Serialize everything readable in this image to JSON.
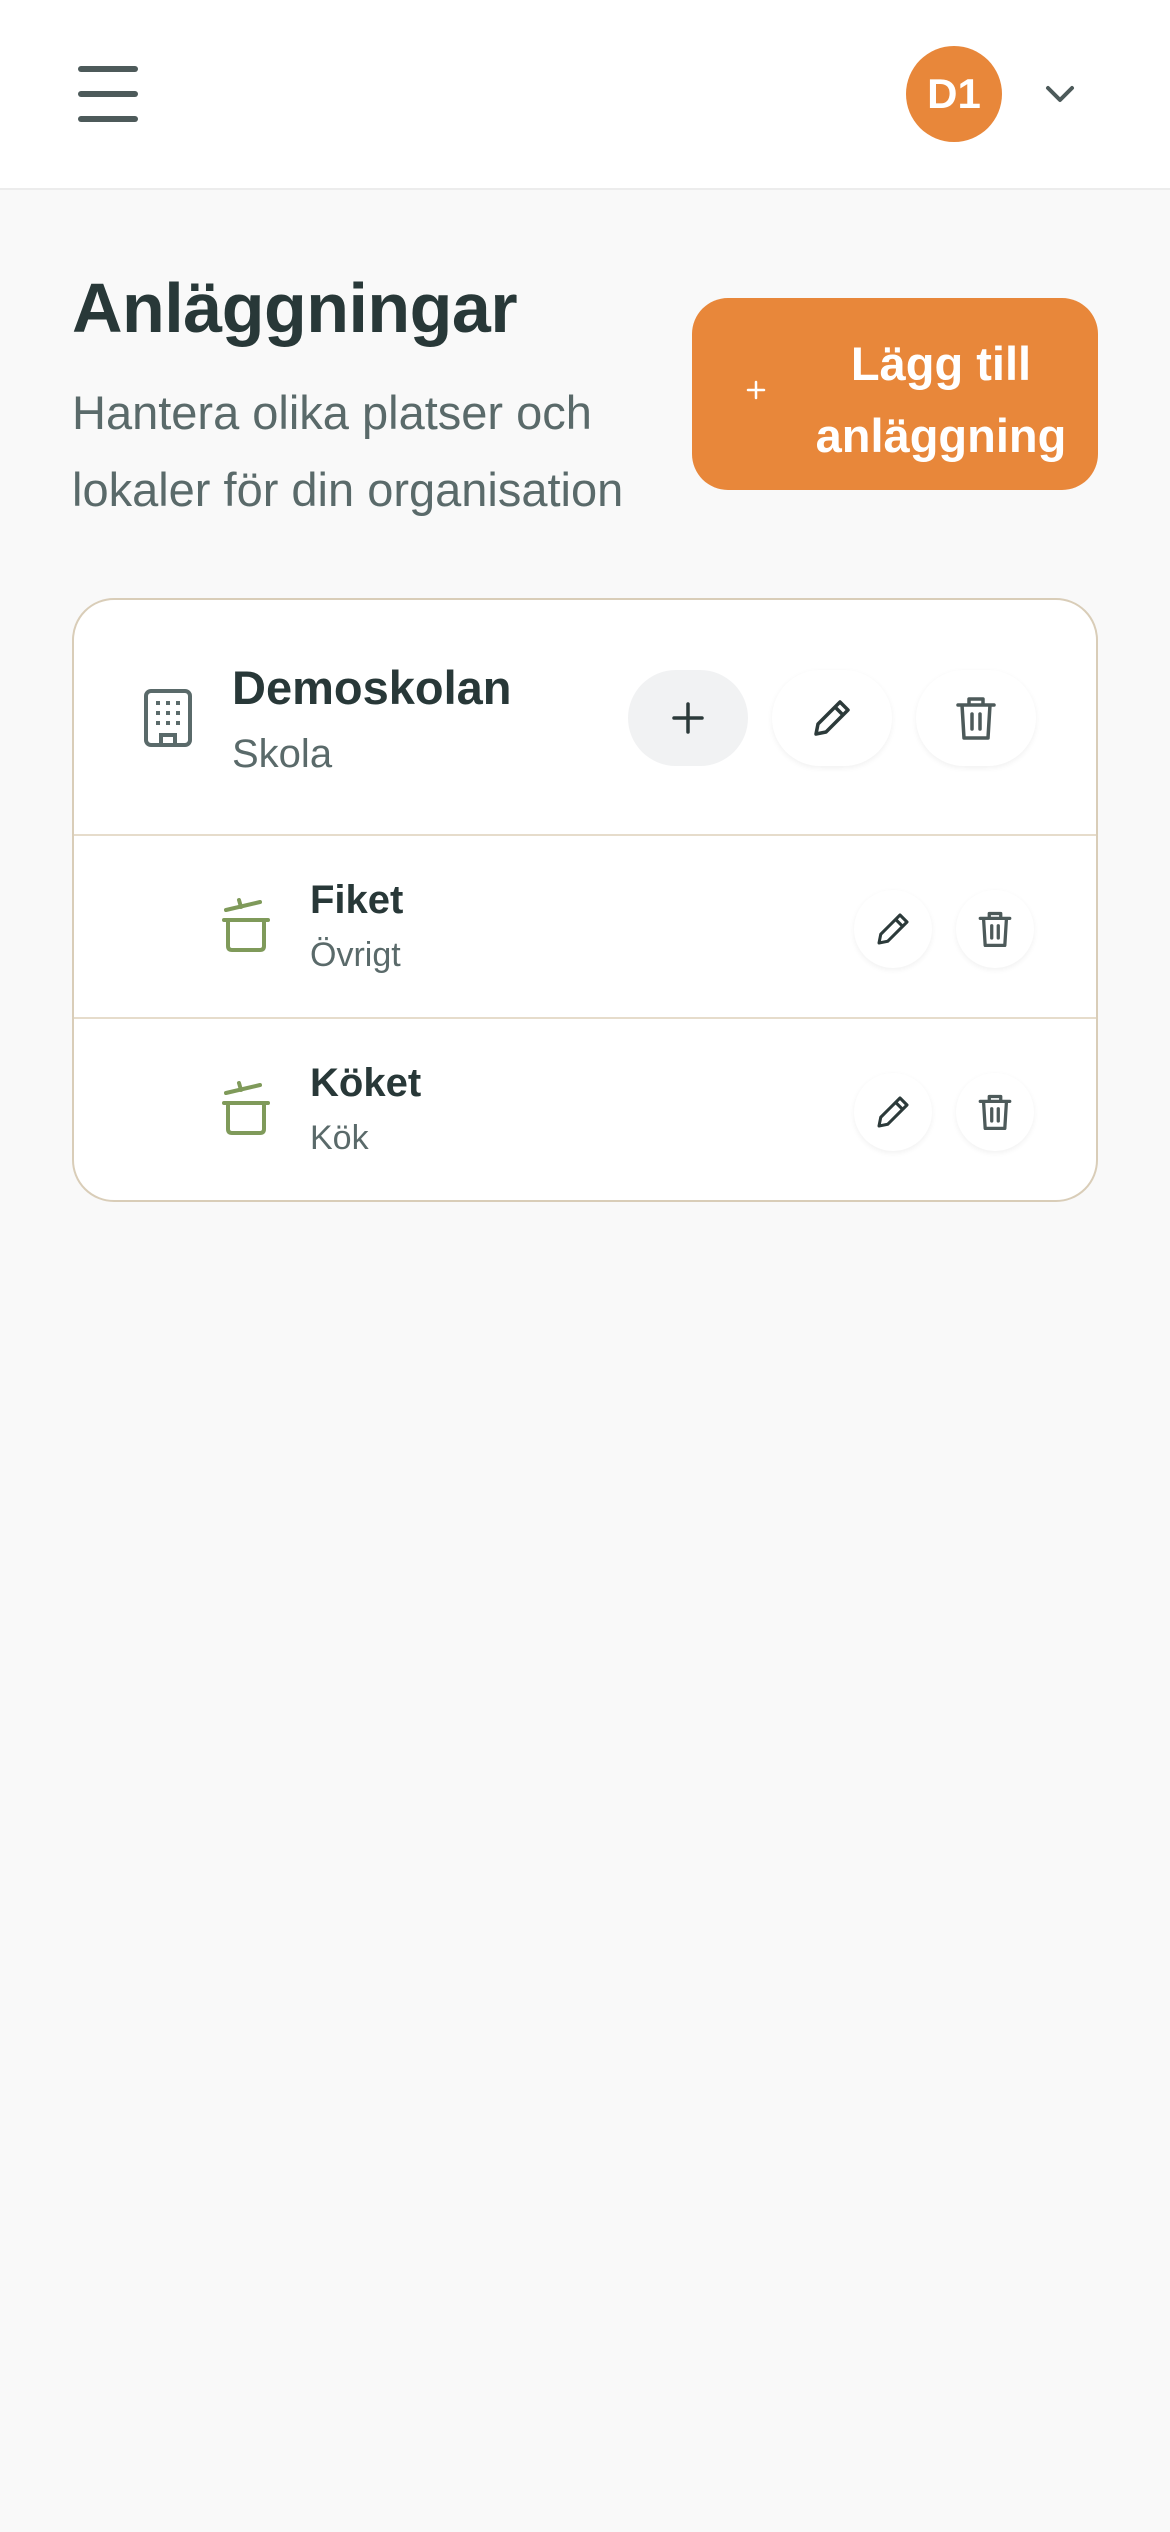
{
  "header": {
    "avatar_initials": "D1",
    "menu_icon": "hamburger-menu-icon",
    "dropdown_icon": "chevron-down-icon"
  },
  "page": {
    "title": "Anläggningar",
    "subtitle": "Hantera olika platser och lokaler för din organisation",
    "add_button_label": "Lägg till anläggning",
    "add_button_icon": "plus-icon"
  },
  "facility": {
    "name": "Demoskolan",
    "type": "Skola",
    "icon": "building-icon",
    "locations": [
      {
        "name": "Fiket",
        "type": "Övrigt",
        "icon": "cooking-pot-icon"
      },
      {
        "name": "Köket",
        "type": "Kök",
        "icon": "cooking-pot-icon"
      }
    ]
  },
  "colors": {
    "accent": "#e8873a",
    "pot_icon": "#7f9a5a",
    "card_border": "#d9cdb8",
    "background": "#f9f9f9",
    "text_dark": "#283838",
    "text_muted": "#5a6a6a"
  }
}
